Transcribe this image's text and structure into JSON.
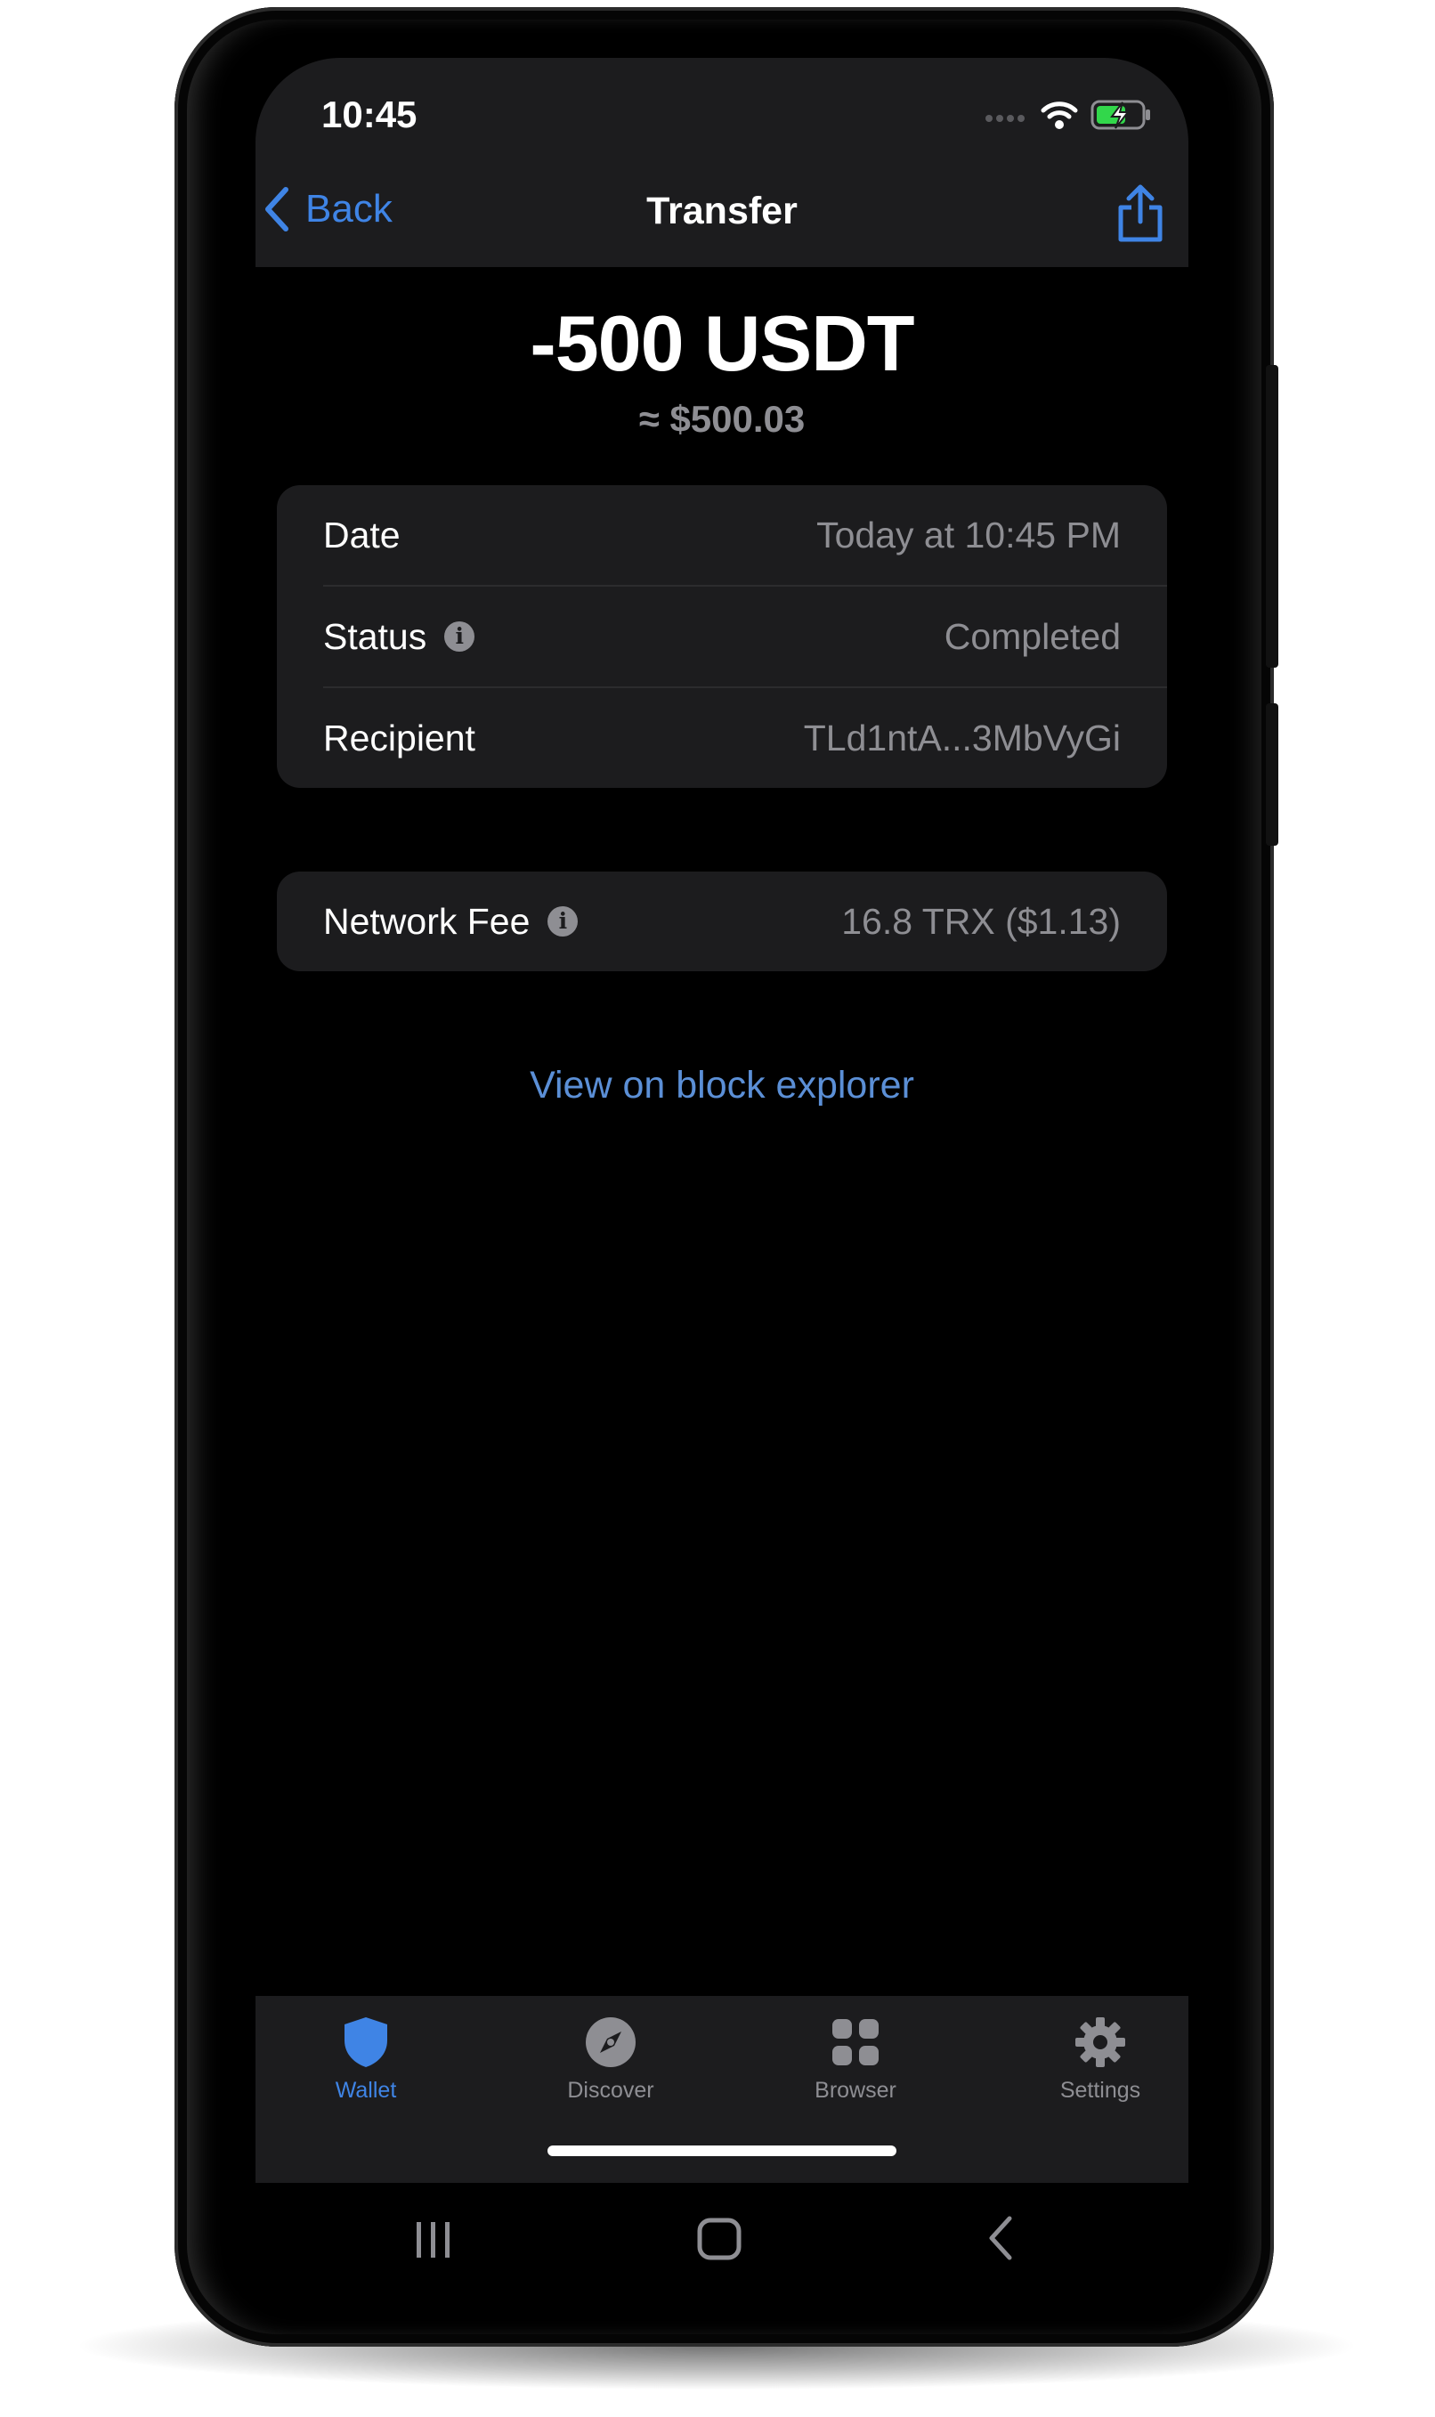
{
  "status_bar": {
    "time": "10:45"
  },
  "nav": {
    "back_label": "Back",
    "title": "Transfer",
    "share_icon": "share-icon"
  },
  "transaction": {
    "amount": "-500 USDT",
    "fiat_value": "≈ $500.03"
  },
  "details": [
    {
      "label": "Date",
      "value": "Today at 10:45 PM",
      "info": false
    },
    {
      "label": "Status",
      "value": "Completed",
      "info": true
    },
    {
      "label": "Recipient",
      "value": "TLd1ntA...3MbVyGi",
      "info": false
    }
  ],
  "fee": {
    "label": "Network Fee",
    "value": "16.8 TRX ($1.13)",
    "info": true
  },
  "explorer_link": "View on block explorer",
  "tabs": [
    {
      "label": "Wallet",
      "icon": "shield-icon",
      "active": true
    },
    {
      "label": "Discover",
      "icon": "compass-icon",
      "active": false
    },
    {
      "label": "Browser",
      "icon": "grid-icon",
      "active": false
    },
    {
      "label": "Settings",
      "icon": "gear-icon",
      "active": false
    }
  ],
  "colors": {
    "accent": "#3f84e5",
    "link": "#5b8fd6",
    "card": "#1c1c1e",
    "secondary_text": "#8e8e93",
    "battery": "#32d74b"
  }
}
